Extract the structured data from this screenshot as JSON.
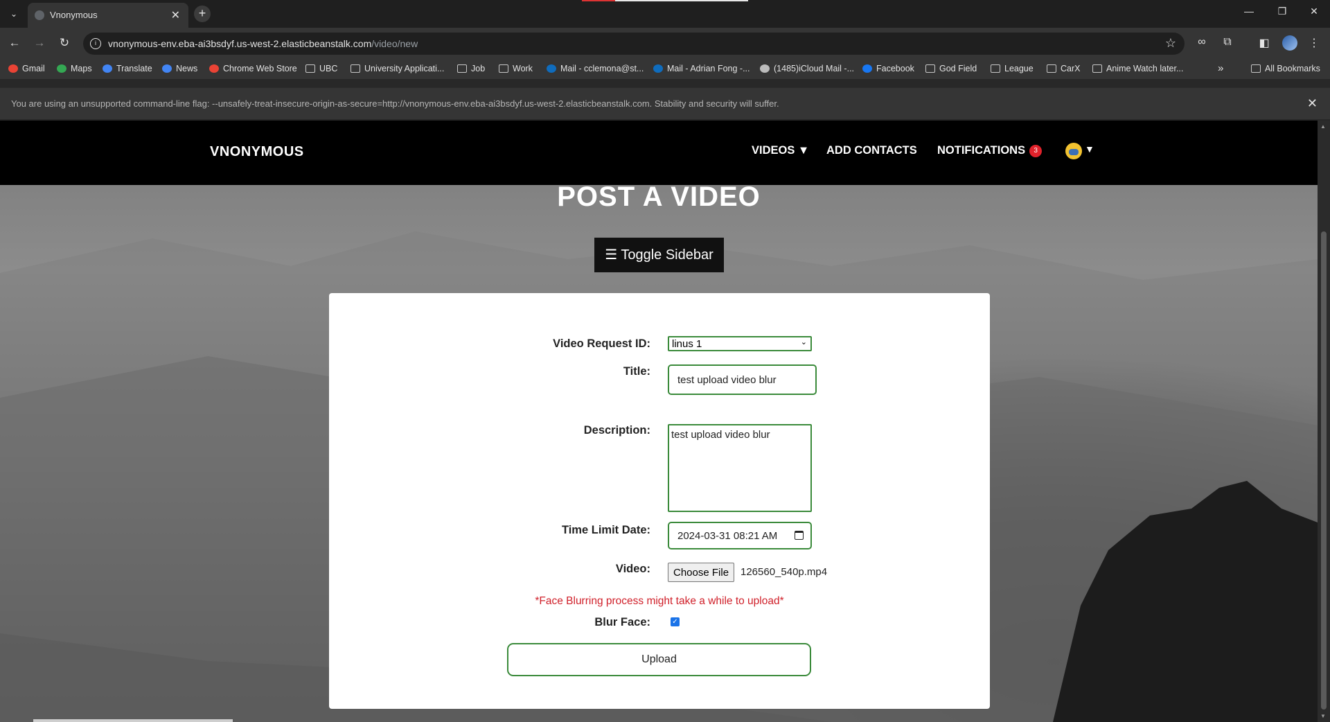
{
  "browser": {
    "tab_title": "Vnonymous",
    "tab_close": "✕",
    "new_tab": "+",
    "url_host": "vnonymous-env.eba-ai3bsdyf.us-west-2.elasticbeanstalk.com",
    "url_path": "/video/new",
    "bookmarks": [
      {
        "label": "Gmail",
        "icon": "gmail-icon",
        "color": "#ea4335"
      },
      {
        "label": "Maps",
        "icon": "maps-icon",
        "color": "#34a853"
      },
      {
        "label": "Translate",
        "icon": "translate-icon",
        "color": "#4285f4"
      },
      {
        "label": "News",
        "icon": "news-icon",
        "color": "#4285f4"
      },
      {
        "label": "Chrome Web Store",
        "icon": "webstore-icon",
        "color": "#ea4335"
      },
      {
        "label": "UBC",
        "icon": "folder-icon"
      },
      {
        "label": "University Applicati...",
        "icon": "folder-icon"
      },
      {
        "label": "Job",
        "icon": "folder-icon"
      },
      {
        "label": "Work",
        "icon": "folder-icon"
      },
      {
        "label": "Mail - cclemona@st...",
        "icon": "outlook-icon",
        "color": "#0f6cbd"
      },
      {
        "label": "Mail - Adrian Fong -...",
        "icon": "outlook-icon",
        "color": "#0f6cbd"
      },
      {
        "label": "(1485)iCloud Mail -...",
        "icon": "apple-icon",
        "color": "#bbbbbb"
      },
      {
        "label": "Facebook",
        "icon": "facebook-icon",
        "color": "#1877f2"
      },
      {
        "label": "God Field",
        "icon": "folder-icon"
      },
      {
        "label": "League",
        "icon": "folder-icon"
      },
      {
        "label": "CarX",
        "icon": "folder-icon"
      },
      {
        "label": "Anime Watch later...",
        "icon": "folder-icon"
      }
    ],
    "bookmarks_more": "»",
    "all_bookmarks": "All Bookmarks",
    "infobar_text": "You are using an unsupported command-line flag: --unsafely-treat-insecure-origin-as-secure=http://vnonymous-env.eba-ai3bsdyf.us-west-2.elasticbeanstalk.com. Stability and security will suffer.",
    "infobar_close": "✕"
  },
  "site": {
    "brand": "VNONYMOUS",
    "nav": {
      "videos": "VIDEOS ▼",
      "add_contacts": "ADD CONTACTS",
      "notifications": "NOTIFICATIONS",
      "notifications_count": "3",
      "user_caret": "▼"
    },
    "page_title": "POST A VIDEO",
    "toggle_sidebar": "☰ Toggle Sidebar"
  },
  "form": {
    "video_request_label": "Video Request ID:",
    "video_request_value": "linus 1",
    "title_label": "Title:",
    "title_value": "test upload video blur",
    "description_label": "Description:",
    "description_value": "test upload video blur",
    "time_limit_label": "Time Limit Date:",
    "time_limit_value": "2024-03-31 08:21  AM",
    "video_label": "Video:",
    "choose_file": "Choose File",
    "file_name": "126560_540p.mp4",
    "warning": "*Face Blurring process might take a while to upload*",
    "blur_face_label": "Blur Face:",
    "blur_face_checked": true,
    "upload_label": "Upload"
  },
  "colors": {
    "accent_green": "#3a8a3a",
    "badge_red": "#e0222b",
    "warning_red": "#d0202a"
  }
}
